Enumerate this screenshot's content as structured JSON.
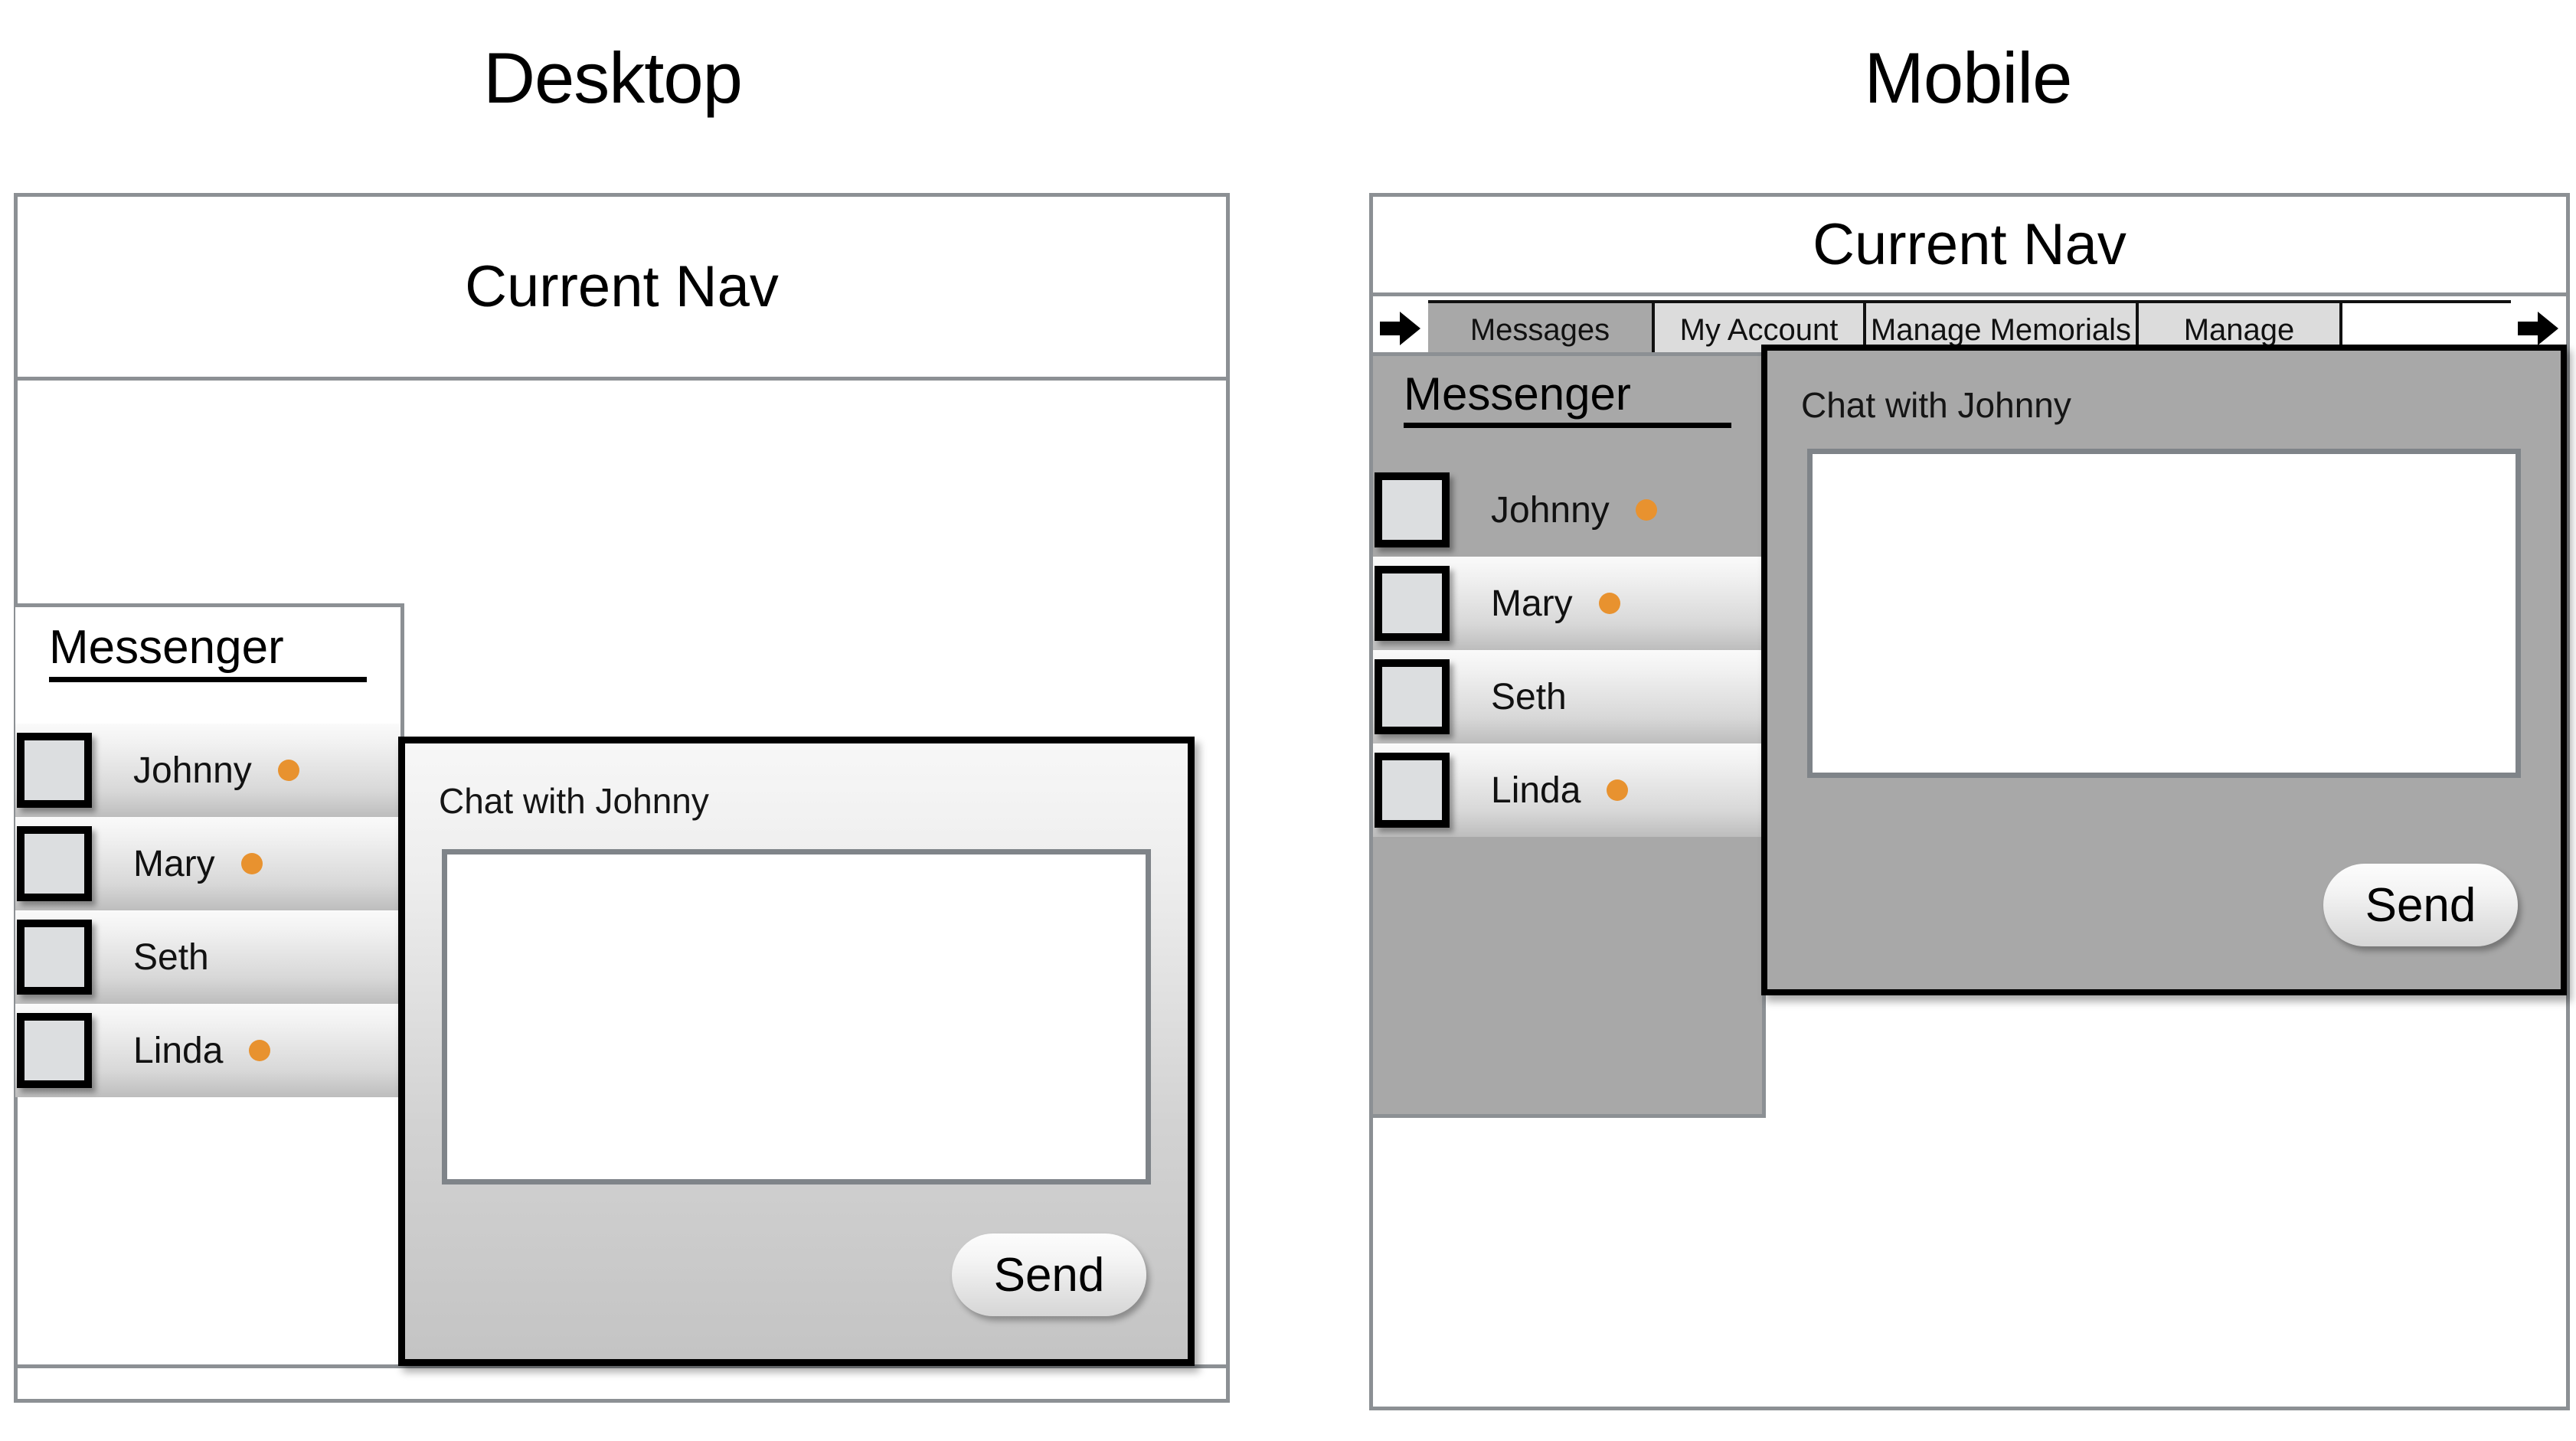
{
  "sections": {
    "desktop_title": "Desktop",
    "mobile_title": "Mobile"
  },
  "desktop": {
    "nav_label": "Current Nav",
    "messenger": {
      "title": "Messenger",
      "contacts": [
        {
          "name": "Johnny",
          "online": true
        },
        {
          "name": "Mary",
          "online": true
        },
        {
          "name": "Seth",
          "online": false
        },
        {
          "name": "Linda",
          "online": true
        }
      ]
    },
    "chat": {
      "title": "Chat with Johnny",
      "message_value": "",
      "send_label": "Send"
    }
  },
  "mobile": {
    "nav_label": "Current Nav",
    "tabs": [
      {
        "label": "Messages",
        "active": true
      },
      {
        "label": "My Account",
        "active": false
      },
      {
        "label": "Manage Memorials",
        "active": false
      },
      {
        "label": "Manage",
        "active": false
      }
    ],
    "scroll_left_icon": "arrow-right-icon",
    "scroll_right_icon": "arrow-right-icon",
    "messenger": {
      "title": "Messenger",
      "contacts": [
        {
          "name": "Johnny",
          "online": true
        },
        {
          "name": "Mary",
          "online": true
        },
        {
          "name": "Seth",
          "online": false
        },
        {
          "name": "Linda",
          "online": true
        }
      ]
    },
    "chat": {
      "title": "Chat with Johnny",
      "message_value": "",
      "send_label": "Send"
    }
  },
  "colors": {
    "status_online": "#e8922f",
    "frame_border": "#8c9094",
    "tab_active_bg": "#a8a8a8",
    "tab_inactive_bg": "#dcdcdc",
    "mobile_panel_bg": "#a8a8a8"
  }
}
